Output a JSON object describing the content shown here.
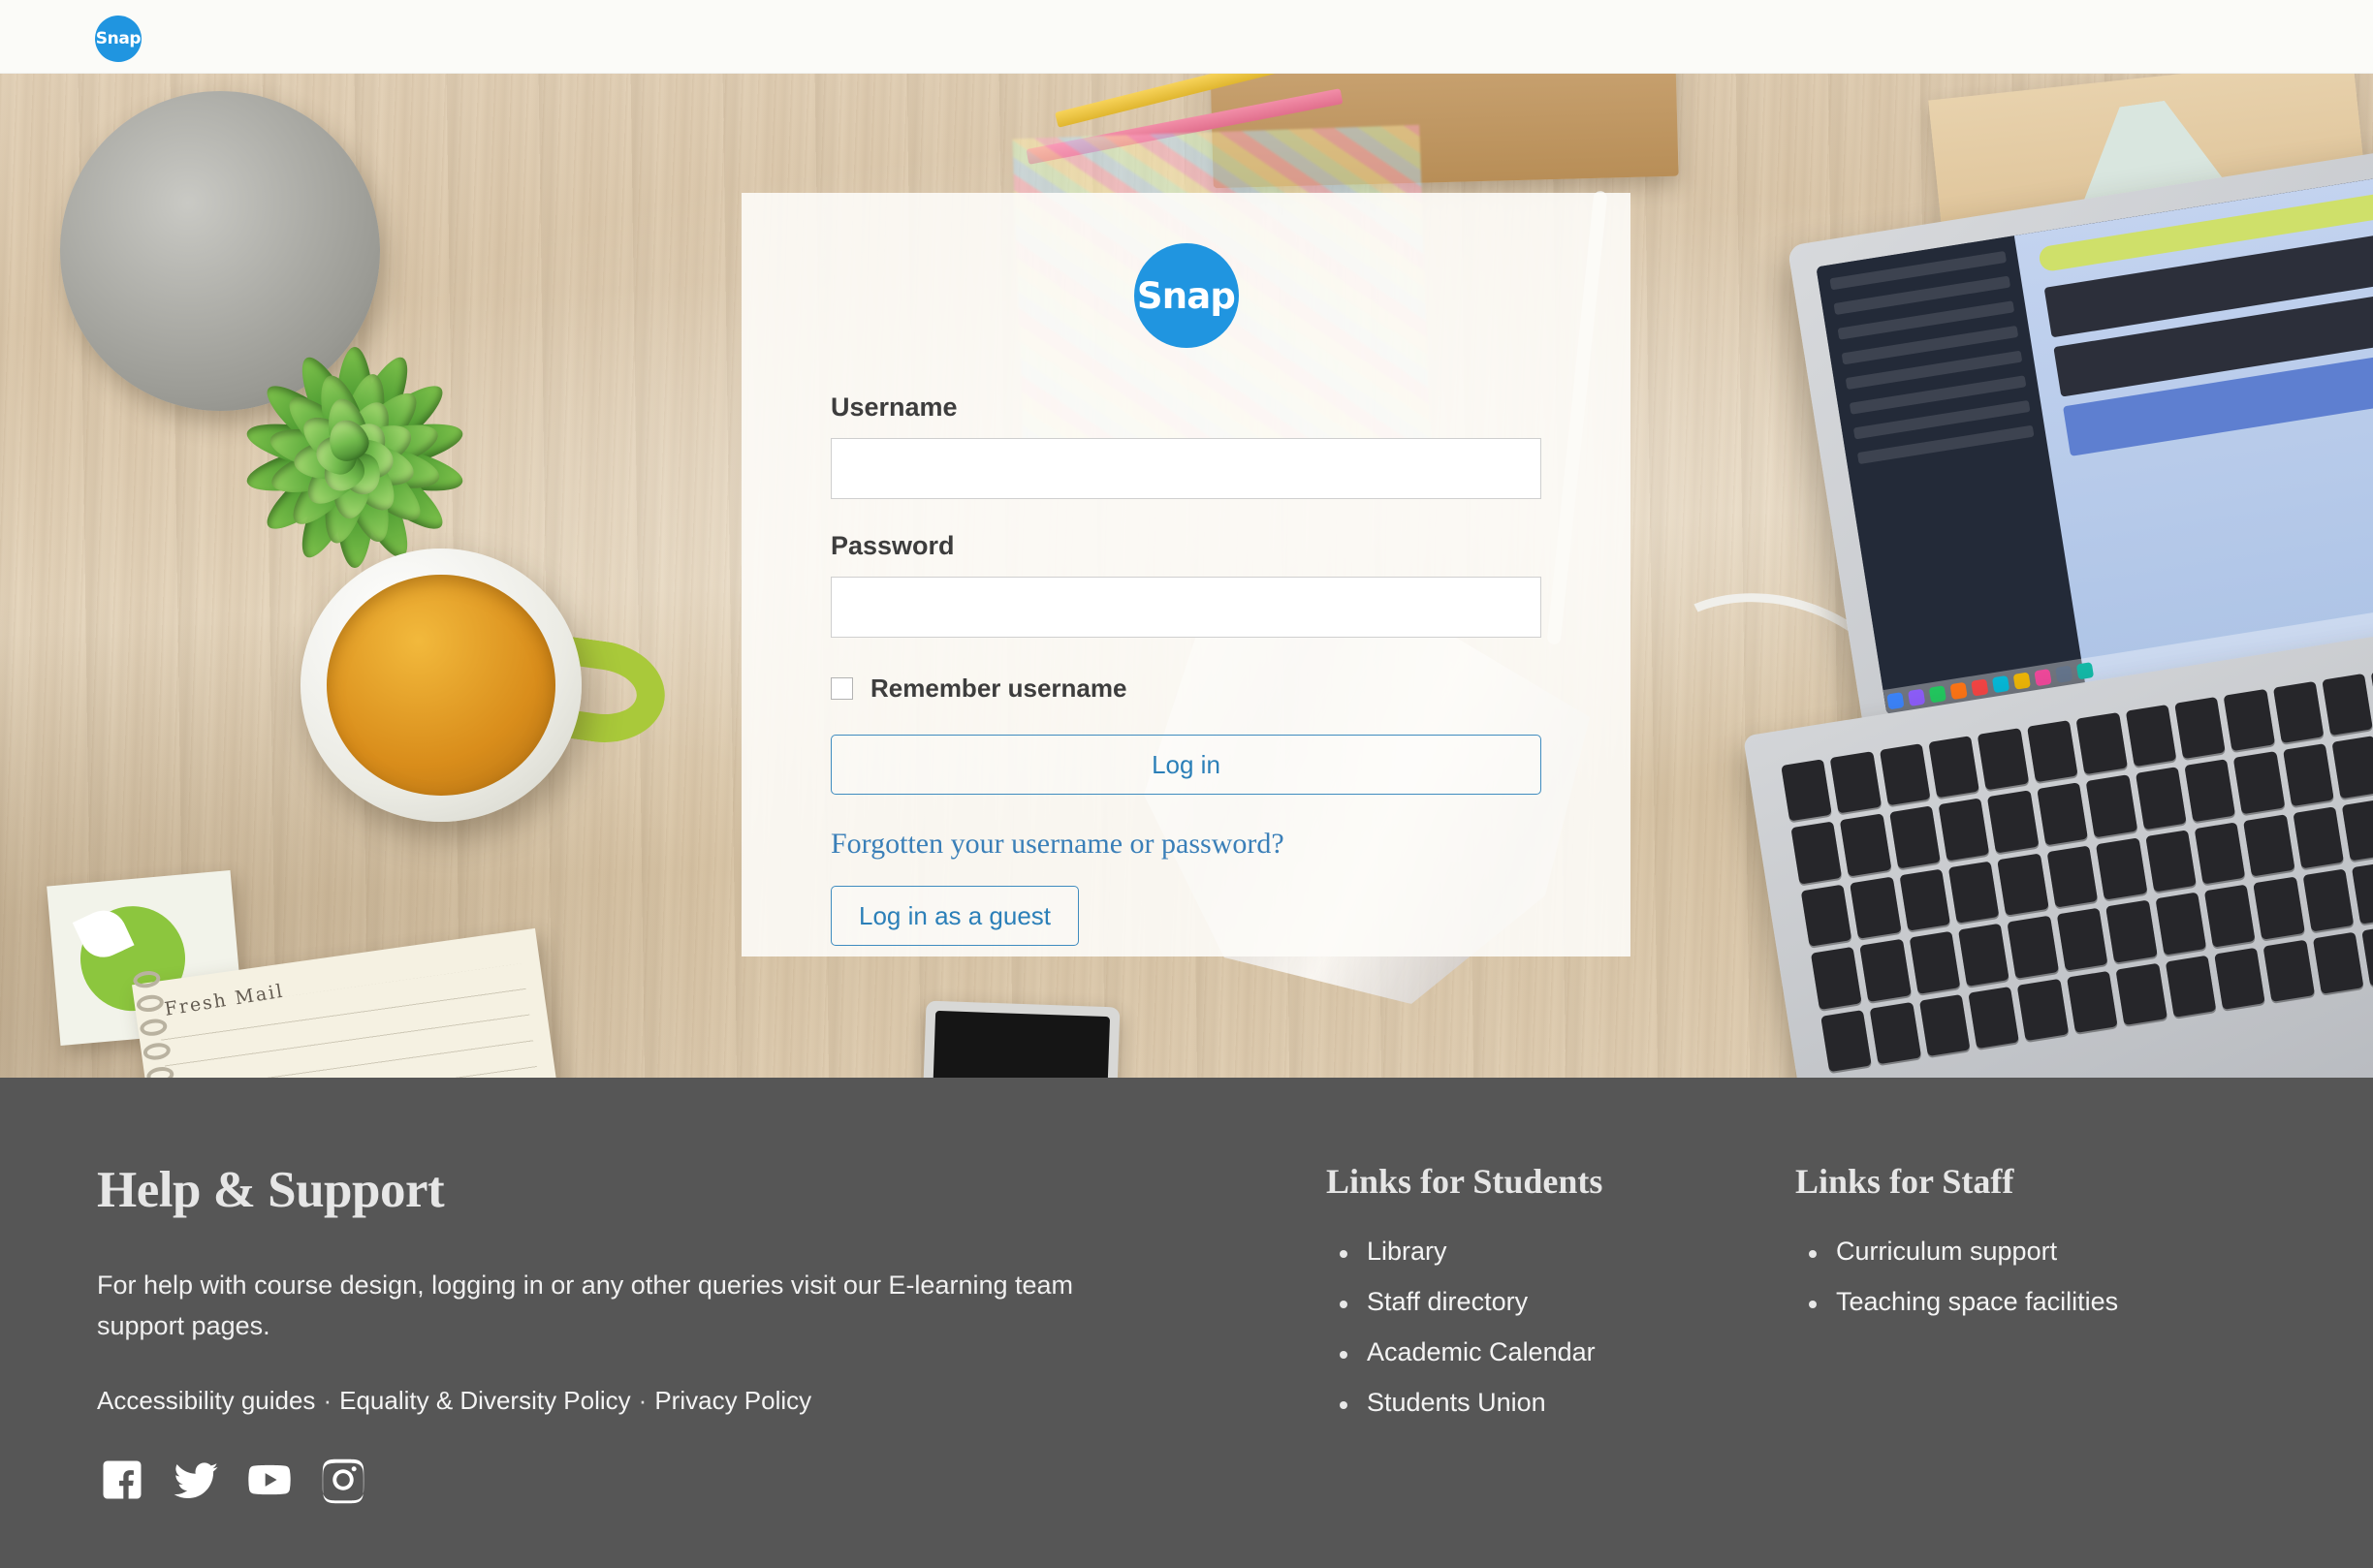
{
  "header": {
    "logo_text": "Snap",
    "logo_icon": "snap-logo-circle",
    "brand_color": "#2095e0"
  },
  "login": {
    "logo_text": "Snap",
    "username_label": "Username",
    "username_value": "",
    "username_placeholder": "",
    "password_label": "Password",
    "password_value": "",
    "password_placeholder": "",
    "remember_label": "Remember username",
    "remember_checked": false,
    "login_button": "Log in",
    "forgot_link": "Forgotten your username or password?",
    "guest_button": "Log in as a guest",
    "link_color": "#3a7fb8",
    "button_border_color": "#3f8cbf"
  },
  "footer": {
    "background_color": "#565656",
    "help": {
      "title": "Help & Support",
      "paragraph": "For help with course design, logging in or any other queries visit our E-learning team support pages.",
      "links": [
        {
          "label": "Accessibility guides"
        },
        {
          "label": "Equality & Diversity Policy"
        },
        {
          "label": "Privacy Policy"
        }
      ],
      "link_separator": "·",
      "socials": [
        {
          "name": "facebook-icon"
        },
        {
          "name": "twitter-icon"
        },
        {
          "name": "youtube-icon"
        },
        {
          "name": "instagram-icon"
        }
      ]
    },
    "students": {
      "title": "Links for Students",
      "items": [
        {
          "label": "Library"
        },
        {
          "label": "Staff directory"
        },
        {
          "label": "Academic Calendar"
        },
        {
          "label": "Students Union"
        }
      ]
    },
    "staff": {
      "title": "Links for Staff",
      "items": [
        {
          "label": "Curriculum support"
        },
        {
          "label": "Teaching space facilities"
        }
      ]
    }
  }
}
